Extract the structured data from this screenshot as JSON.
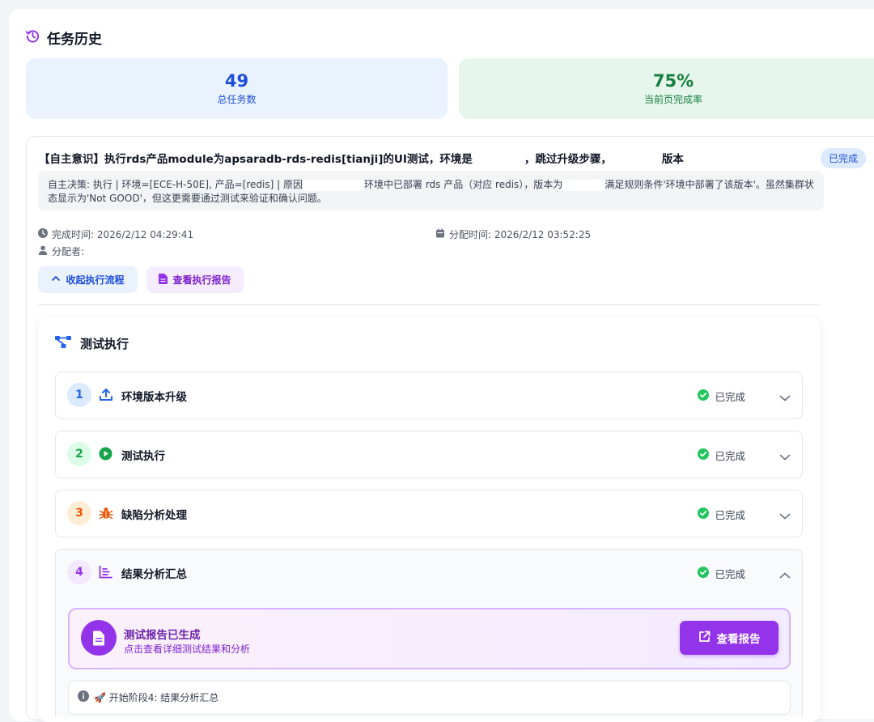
{
  "page": {
    "title": "任务历史",
    "icons": {
      "title": "history-icon"
    }
  },
  "stats": {
    "total_tasks": {
      "value": "49",
      "label": "总任务数"
    },
    "completion_rate": {
      "value": "75%",
      "label": "当前页完成率"
    }
  },
  "task": {
    "title_part1": "【自主意识】执行rds产品module为apsaradb-rds-redis[tianji]的UI测试，环境是",
    "title_part2": "，跳过升级步骤，",
    "title_part3": "版本",
    "status_badge": "已完成",
    "decision_part1": "自主决策: 执行 | 环境=[ECE-H-50E], 产品=[redis] | 原因",
    "decision_part2": "环境中已部署 rds 产品（对应 redis），版本为",
    "decision_part3": "满足规则条件'环境中部署了该版本'。虽然集群状态显示为'Not GOOD'，但这更需要通过测试来验证和确认问题。",
    "completed_time": "完成时间: 2026/2/12 04:29:41",
    "assigned_time": "分配时间: 2026/2/12 03:52:25",
    "assignee": "分配者:",
    "collapse_button": "收起执行流程",
    "view_report_button": "查看执行报告"
  },
  "execution": {
    "title": "测试执行",
    "stages": [
      {
        "num": "1",
        "label": "环境版本升级",
        "status": "已完成",
        "icon": "upload-icon",
        "expanded": false
      },
      {
        "num": "2",
        "label": "测试执行",
        "status": "已完成",
        "icon": "play-icon",
        "expanded": false
      },
      {
        "num": "3",
        "label": "缺陷分析处理",
        "status": "已完成",
        "icon": "bug-icon",
        "expanded": false
      },
      {
        "num": "4",
        "label": "结果分析汇总",
        "status": "已完成",
        "icon": "chart-icon",
        "expanded": true
      }
    ],
    "report": {
      "title": "测试报告已生成",
      "subtitle": "点击查看详细测试结果和分析",
      "button": "查看报告"
    },
    "log_line": "🚀 开始阶段4: 结果分析汇总"
  },
  "colors": {
    "blue": "#1d4ed8",
    "green": "#15803d",
    "purple": "#9333ea",
    "orange": "#ea580c",
    "success": "#22c55e"
  }
}
